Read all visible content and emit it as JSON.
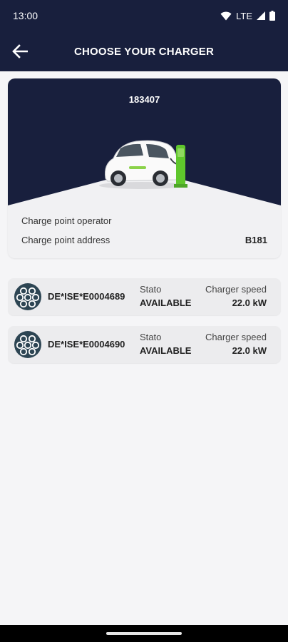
{
  "status_bar": {
    "time": "13:00",
    "network": "LTE"
  },
  "app_bar": {
    "title": "CHOOSE YOUR CHARGER"
  },
  "station": {
    "id": "183407",
    "operator_label": "Charge point operator",
    "operator_value": "",
    "address_label": "Charge point address",
    "address_value": "B181"
  },
  "connectors": [
    {
      "id": "DE*ISE*E0004689",
      "status_label": "Stato",
      "status": "AVAILABLE",
      "speed_label": "Charger speed",
      "speed": "22.0 kW"
    },
    {
      "id": "DE*ISE*E0004690",
      "status_label": "Stato",
      "status": "AVAILABLE",
      "speed_label": "Charger speed",
      "speed": "22.0 kW"
    }
  ],
  "colors": {
    "primary": "#181f3d",
    "background": "#f5f5f7",
    "card": "#ececee",
    "charger_green": "#5fc62c",
    "connector_icon": "#2d4553"
  }
}
